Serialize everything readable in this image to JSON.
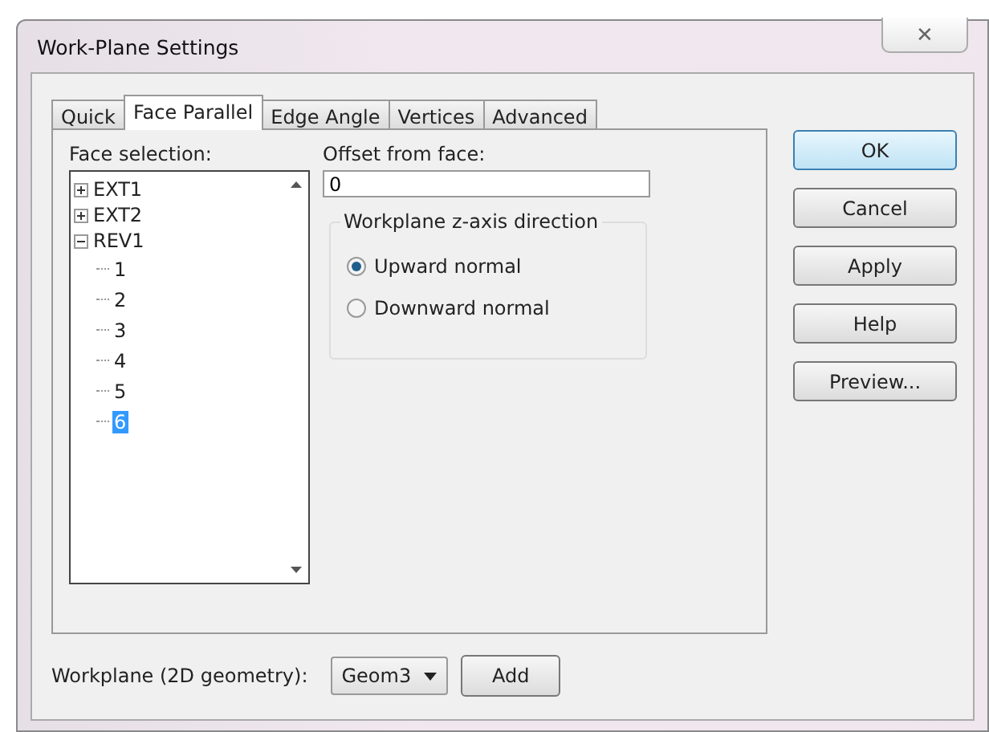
{
  "window": {
    "title": "Work-Plane Settings",
    "close": "✕"
  },
  "tabs": [
    {
      "label": "Quick",
      "selected": false
    },
    {
      "label": "Face Parallel",
      "selected": true
    },
    {
      "label": "Edge Angle",
      "selected": false
    },
    {
      "label": "Vertices",
      "selected": false
    },
    {
      "label": "Advanced",
      "selected": false
    }
  ],
  "face_selection": {
    "label": "Face selection:",
    "items": [
      {
        "label": "EXT1",
        "expanded": false,
        "selected": false
      },
      {
        "label": "EXT2",
        "expanded": false,
        "selected": false
      },
      {
        "label": "REV1",
        "expanded": true,
        "selected": false,
        "children": [
          {
            "label": "1",
            "selected": false
          },
          {
            "label": "2",
            "selected": false
          },
          {
            "label": "3",
            "selected": false
          },
          {
            "label": "4",
            "selected": false
          },
          {
            "label": "5",
            "selected": false
          },
          {
            "label": "6",
            "selected": true
          }
        ]
      }
    ]
  },
  "offset": {
    "label": "Offset from face:",
    "value": "0"
  },
  "direction": {
    "title": "Workplane z-axis direction",
    "options": [
      {
        "label": "Upward normal",
        "selected": true
      },
      {
        "label": "Downward normal",
        "selected": false
      }
    ]
  },
  "buttons": [
    {
      "label": "OK",
      "default": true
    },
    {
      "label": "Cancel",
      "default": false
    },
    {
      "label": "Apply",
      "default": false
    },
    {
      "label": "Help",
      "default": false
    },
    {
      "label": "Preview...",
      "default": false
    }
  ],
  "workplane": {
    "label": "Workplane (2D geometry):",
    "value": "Geom3",
    "button": "Add"
  }
}
